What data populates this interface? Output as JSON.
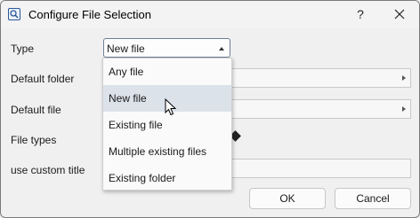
{
  "window": {
    "title": "Configure File Selection",
    "help_label": "?",
    "icons": {
      "app": "search-icon",
      "close": "close-icon"
    }
  },
  "form": {
    "type_label": "Type",
    "type_value": "New file",
    "default_folder_label": "Default folder",
    "default_file_label": "Default file",
    "file_types_label": "File types",
    "custom_title_label": "use custom title"
  },
  "dropdown": {
    "options": [
      "Any file",
      "New file",
      "Existing file",
      "Multiple existing files",
      "Existing folder"
    ],
    "selected": "New file"
  },
  "buttons": {
    "ok": "OK",
    "cancel": "Cancel"
  },
  "colors": {
    "selection": "#dce2ea",
    "accent": "#2b5797"
  }
}
